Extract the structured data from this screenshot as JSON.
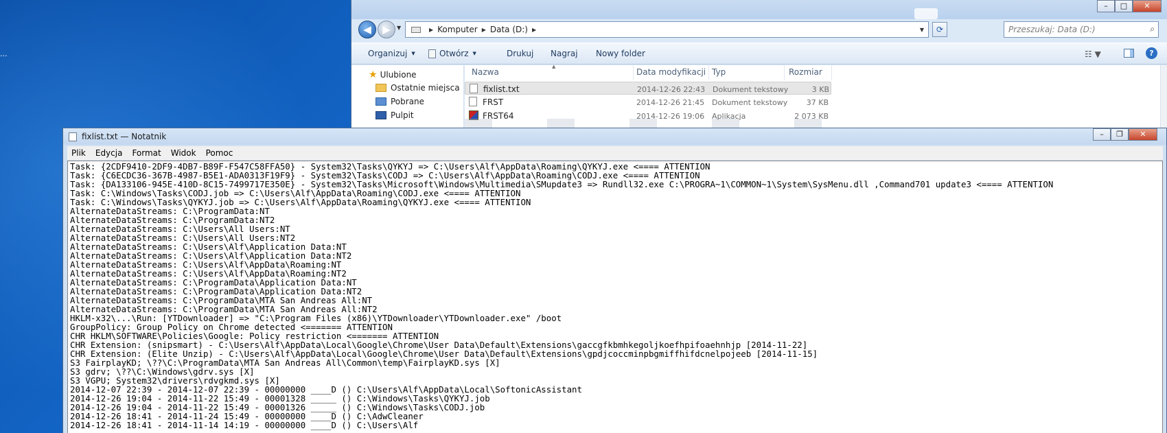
{
  "desktop": {
    "dots": "..."
  },
  "explorer": {
    "address": {
      "crumbs": [
        "Komputer",
        "Data (D:)"
      ]
    },
    "search_placeholder": "Przeszukaj: Data (D:)",
    "toolbar": {
      "organize": "Organizuj",
      "open": "Otwórz",
      "print": "Drukuj",
      "burn": "Nagraj",
      "new_folder": "Nowy folder"
    },
    "nav": {
      "favorites": "Ulubione",
      "recent": "Ostatnie miejsca",
      "downloads": "Pobrane",
      "desktop": "Pulpit"
    },
    "columns": {
      "name": "Nazwa",
      "modified": "Data modyfikacji",
      "type": "Typ",
      "size": "Rozmiar"
    },
    "files": [
      {
        "name": "fixlist.txt",
        "modified": "2014-12-26 22:43",
        "type": "Dokument tekstowy",
        "size": "3 KB",
        "icon": "text-file-icon"
      },
      {
        "name": "FRST",
        "modified": "2014-12-26 21:45",
        "type": "Dokument tekstowy",
        "size": "37 KB",
        "icon": "text-file-icon"
      },
      {
        "name": "FRST64",
        "modified": "2014-12-26 19:06",
        "type": "Aplikacja",
        "size": "2 073 KB",
        "icon": "application-icon"
      }
    ]
  },
  "notepad": {
    "title": "fixlist.txt — Notatnik",
    "menu": [
      "Plik",
      "Edycja",
      "Format",
      "Widok",
      "Pomoc"
    ],
    "lines": [
      "Task: {2CDF9410-2DF9-4DB7-B89F-F547C58FFA50} - System32\\Tasks\\QYKYJ => C:\\Users\\Alf\\AppData\\Roaming\\QYKYJ.exe <==== ATTENTION",
      "Task: {C6ECDC36-367B-4987-B5E1-ADA0313F19F9} - System32\\Tasks\\CODJ => C:\\Users\\Alf\\AppData\\Roaming\\CODJ.exe <==== ATTENTION",
      "Task: {DA133106-945E-410D-8C15-7499717E350E} - System32\\Tasks\\Microsoft\\Windows\\Multimedia\\SMupdate3 => Rundll32.exe C:\\PROGRA~1\\COMMON~1\\System\\SysMenu.dll ,Command701 update3 <==== ATTENTION",
      "Task: C:\\Windows\\Tasks\\CODJ.job => C:\\Users\\Alf\\AppData\\Roaming\\CODJ.exe <==== ATTENTION",
      "Task: C:\\Windows\\Tasks\\QYKYJ.job => C:\\Users\\Alf\\AppData\\Roaming\\QYKYJ.exe <==== ATTENTION",
      "AlternateDataStreams: C:\\ProgramData:NT",
      "AlternateDataStreams: C:\\ProgramData:NT2",
      "AlternateDataStreams: C:\\Users\\All Users:NT",
      "AlternateDataStreams: C:\\Users\\All Users:NT2",
      "AlternateDataStreams: C:\\Users\\Alf\\Application Data:NT",
      "AlternateDataStreams: C:\\Users\\Alf\\Application Data:NT2",
      "AlternateDataStreams: C:\\Users\\Alf\\AppData\\Roaming:NT",
      "AlternateDataStreams: C:\\Users\\Alf\\AppData\\Roaming:NT2",
      "AlternateDataStreams: C:\\ProgramData\\Application Data:NT",
      "AlternateDataStreams: C:\\ProgramData\\Application Data:NT2",
      "AlternateDataStreams: C:\\ProgramData\\MTA San Andreas All:NT",
      "AlternateDataStreams: C:\\ProgramData\\MTA San Andreas All:NT2",
      "HKLM-x32\\...\\Run: [YTDownloader] => \"C:\\Program Files (x86)\\YTDownloader\\YTDownloader.exe\" /boot",
      "GroupPolicy: Group Policy on Chrome detected <======= ATTENTION",
      "CHR HKLM\\SOFTWARE\\Policies\\Google: Policy restriction <======= ATTENTION",
      "CHR Extension: (snipsmart) - C:\\Users\\Alf\\AppData\\Local\\Google\\Chrome\\User Data\\Default\\Extensions\\gaccgfkbmhkegoljkoefhpifoaehnhjp [2014-11-22]",
      "CHR Extension: (Elite Unzip) - C:\\Users\\Alf\\AppData\\Local\\Google\\Chrome\\User Data\\Default\\Extensions\\gpdjcoccminpbgmiffhifdcnelpojeeb [2014-11-15]",
      "S3 FairplayKD; \\??\\C:\\ProgramData\\MTA San Andreas All\\Common\\temp\\FairplayKD.sys [X]",
      "S3 gdrv; \\??\\C:\\Windows\\gdrv.sys [X]",
      "S3 VGPU; System32\\drivers\\rdvgkmd.sys [X]",
      "2014-12-07 22:39 - 2014-12-07 22:39 - 00000000 ____D () C:\\Users\\Alf\\AppData\\Local\\SoftonicAssistant",
      "2014-12-26 19:04 - 2014-11-22 15:49 - 00001328 _____ () C:\\Windows\\Tasks\\QYKYJ.job",
      "2014-12-26 19:04 - 2014-11-22 15:49 - 00001326 _____ () C:\\Windows\\Tasks\\CODJ.job",
      "2014-12-26 18:41 - 2014-11-24 15:49 - 00000000 ____D () C:\\AdwCleaner",
      "2014-12-26 18:41 - 2014-11-14 14:19 - 00000000 ____D () C:\\Users\\Alf"
    ]
  }
}
